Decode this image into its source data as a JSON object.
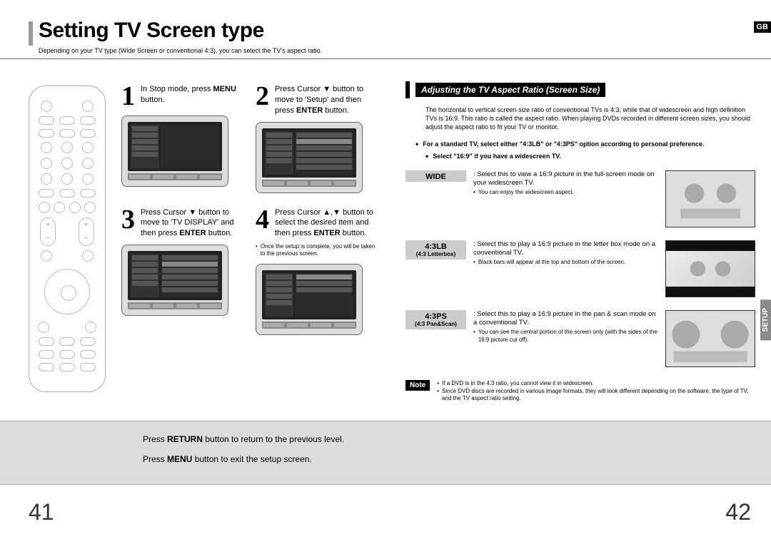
{
  "header": {
    "title": "Setting TV Screen type",
    "subtitle": "Depending on your TV type (Wide Screen  or conventional 4:3), you can select the TV's aspect ratio.",
    "badge_gb": "GB"
  },
  "steps": [
    {
      "num": "1",
      "text_pre": "In Stop mode, press ",
      "text_bold": "MENU",
      "text_post": " button."
    },
    {
      "num": "2",
      "text_pre": "Press Cursor ▼ button to move to 'Setup' and then press ",
      "text_bold": "ENTER",
      "text_post": " button."
    },
    {
      "num": "3",
      "text_pre": "Press Cursor ▼ button to move to 'TV DISPLAY' and then press ",
      "text_bold": "ENTER",
      "text_post": " button."
    },
    {
      "num": "4",
      "text_pre": "Press Cursor ▲,▼ button to select the desired item and then press ",
      "text_bold": "ENTER",
      "text_post": " button.",
      "note": "Once the setup is complete, you will be taken to the previous screen."
    }
  ],
  "right": {
    "heading": "Adjusting the TV Aspect Ratio (Screen Size)",
    "intro": "The horizontal to vertical screen size ratio of conventional TVs is 4:3, while that of widescreen and high definition TVs is 16:9. This ratio is called the aspect ratio. When playing DVDs recorded in different screen sizes, you should adjust the aspect ratio to fit your TV or monitor.",
    "bullet1": "For a standard TV, select either \"4:3LB\" or \"4:3PS\" option according to personal preference.",
    "bullet2": "Select \"16:9\" if you have a widescreen TV.",
    "options": [
      {
        "label": "WIDE",
        "sublabel": "",
        "desc": "Select this to view a 16:9 picture in the full-screen mode on your widescreen TV.",
        "sub": "You can enjoy the widescreen aspect."
      },
      {
        "label": "4:3LB",
        "sublabel": "(4:3 Letterbox)",
        "desc": "Select this to play a 16:9 picture in the letter box mode on a conventional TV.",
        "sub": "Black bars will appear at the top and bottom of the screen."
      },
      {
        "label": "4:3PS",
        "sublabel": "(4:3 Pan&Scan)",
        "desc": "Select this to play a 16:9 picture in the pan & scan mode on a conventional TV.",
        "sub": "You can see the central portion of the screen only (with the sides of the 16:9 picture cut off)."
      }
    ],
    "note_label": "Note",
    "note1": "If a DVD is in the 4:3 ratio, you cannot view it in widescreen.",
    "note2": "Since DVD discs are recorded in various image formats, they will look different depending on the software, the type of TV, and the TV aspect ratio setting."
  },
  "side_tab": "SETUP",
  "footer": {
    "line1_pre": "Press ",
    "line1_bold": "RETURN",
    "line1_post": " button to return to the previous level.",
    "line2_pre": "Press ",
    "line2_bold": "MENU",
    "line2_post": " button to exit the setup screen."
  },
  "page_left": "41",
  "page_right": "42"
}
